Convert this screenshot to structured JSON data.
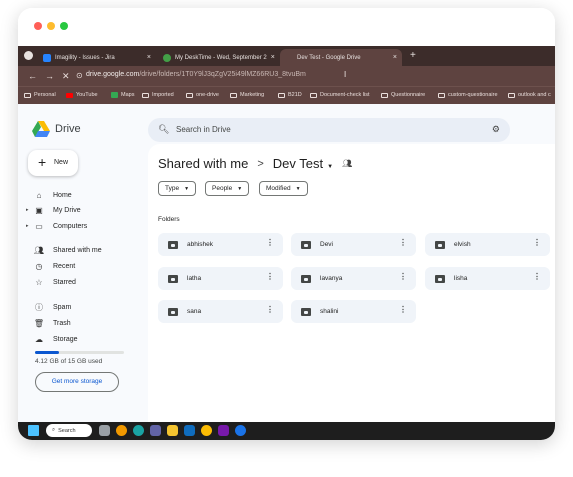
{
  "browser": {
    "tabs": [
      {
        "title": "Imagility - Issues - Jira",
        "color": "#2684ff"
      },
      {
        "title": "My DeskTime - Wed, September 2",
        "color": "#43a047"
      },
      {
        "title": "Dev Test - Google Drive",
        "color": "#5e4340"
      }
    ],
    "new_tab": "+",
    "url_domain": "drive.google.com",
    "url_path": "/drive/folders/1T0Y9lJ3qZgV25i49lMZ66RU3_8tvuBm",
    "bookmarks": [
      "Personal",
      "YouTube",
      "Maps",
      "Imported",
      "one-drive",
      "Marketing",
      "B21D",
      "Document-check list",
      "Questionnaire",
      "custom-questionaire",
      "outlook and c"
    ]
  },
  "drive": {
    "app_name": "Drive",
    "search_placeholder": "Search in Drive",
    "new_label": "New",
    "nav": [
      {
        "label": "Home",
        "icon": "home-icon"
      },
      {
        "label": "My Drive",
        "icon": "my-drive-icon"
      },
      {
        "label": "Computers",
        "icon": "computers-icon"
      },
      {
        "label": "Shared with me",
        "icon": "shared-icon"
      },
      {
        "label": "Recent",
        "icon": "clock-icon"
      },
      {
        "label": "Starred",
        "icon": "star-icon"
      },
      {
        "label": "Spam",
        "icon": "spam-icon"
      },
      {
        "label": "Trash",
        "icon": "trash-icon"
      },
      {
        "label": "Storage",
        "icon": "cloud-icon"
      }
    ],
    "storage_text": "4.12 GB of 15 GB used",
    "storage_fraction": 0.275,
    "storage_button": "Get more storage",
    "breadcrumb_root": "Shared with me",
    "breadcrumb_sep": ">",
    "breadcrumb_current": "Dev Test",
    "filters": [
      "Type",
      "People",
      "Modified"
    ],
    "section_label": "Folders",
    "folders": [
      "abhishek",
      "Devi",
      "elvish",
      "latha",
      "lavanya",
      "lisha",
      "sana",
      "shalini"
    ]
  },
  "taskbar": {
    "search_label": "Search"
  }
}
